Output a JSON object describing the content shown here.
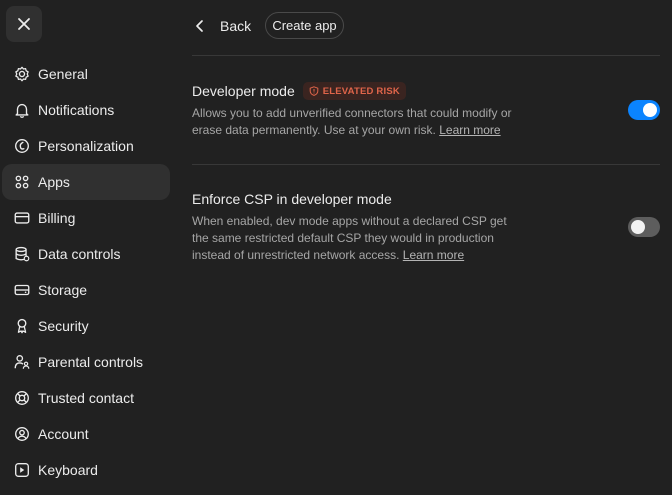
{
  "sidebar": {
    "items": [
      {
        "label": "General",
        "icon": "gear-icon"
      },
      {
        "label": "Notifications",
        "icon": "bell-icon"
      },
      {
        "label": "Personalization",
        "icon": "personalization-icon"
      },
      {
        "label": "Apps",
        "icon": "apps-grid-icon"
      },
      {
        "label": "Billing",
        "icon": "credit-card-icon"
      },
      {
        "label": "Data controls",
        "icon": "database-icon"
      },
      {
        "label": "Storage",
        "icon": "storage-drive-icon"
      },
      {
        "label": "Security",
        "icon": "security-key-icon"
      },
      {
        "label": "Parental controls",
        "icon": "parental-controls-icon"
      },
      {
        "label": "Trusted contact",
        "icon": "lifebuoy-icon"
      },
      {
        "label": "Account",
        "icon": "account-icon"
      },
      {
        "label": "Keyboard",
        "icon": "keyboard-icon"
      }
    ],
    "active": "Apps"
  },
  "header": {
    "back_label": "Back",
    "create_label": "Create app"
  },
  "settings": {
    "developer_mode": {
      "title": "Developer mode",
      "badge": "ELEVATED RISK",
      "description": "Allows you to add unverified connectors that could modify or erase data permanently. Use at your own risk.",
      "link": "Learn more",
      "enabled": true
    },
    "enforce_csp": {
      "title": "Enforce CSP in developer mode",
      "description": "When enabled, dev mode apps without a declared CSP get the same restricted default CSP they would in production instead of unrestricted network access.",
      "link": "Learn more",
      "enabled": false
    }
  },
  "colors": {
    "background": "#212121",
    "toggle_on": "#0b84ff",
    "toggle_off": "#5d5d5d",
    "risk_badge_text": "#e0654a",
    "risk_badge_bg": "#3a2420"
  }
}
